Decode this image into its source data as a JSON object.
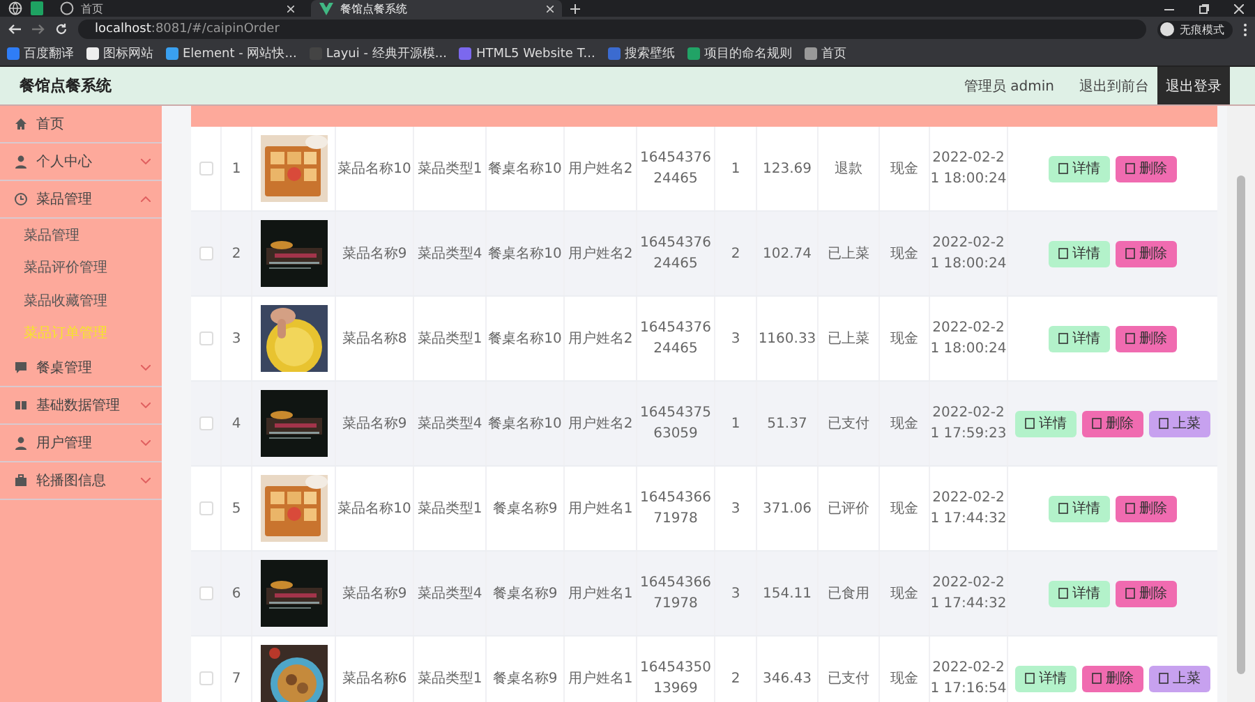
{
  "browser": {
    "tabs": [
      {
        "label": "首页",
        "selected": false
      },
      {
        "label": "餐馆点餐系统",
        "selected": true
      }
    ],
    "address": {
      "host": "localhost",
      "rest": ":8081/#/caipinOrder"
    },
    "bookmarks": [
      "百度翻译",
      "图标网站",
      "Element - 网站快...",
      "Layui - 经典开源模...",
      "HTML5 Website T...",
      "搜索壁纸",
      "项目的命名规则",
      "首页"
    ],
    "profile": "无痕模式"
  },
  "header": {
    "title": "餐馆点餐系统",
    "user": "管理员 admin",
    "links": [
      {
        "label": "退出到前台",
        "selected": false
      },
      {
        "label": "退出登录",
        "selected": true
      }
    ]
  },
  "sidebar": {
    "items": [
      {
        "label": "首页"
      },
      {
        "label": "个人中心",
        "expanded": false
      },
      {
        "label": "菜品管理",
        "expanded": true,
        "children": [
          {
            "label": "菜品管理",
            "selected": false
          },
          {
            "label": "菜品评价管理",
            "selected": false
          },
          {
            "label": "菜品收藏管理",
            "selected": false
          },
          {
            "label": "菜品订单管理",
            "selected": true
          }
        ]
      },
      {
        "label": "餐桌管理",
        "expanded": false
      },
      {
        "label": "基础数据管理",
        "expanded": false
      },
      {
        "label": "用户管理",
        "expanded": false
      },
      {
        "label": "轮播图信息",
        "expanded": false
      }
    ]
  },
  "table": {
    "rows": [
      {
        "checked": false,
        "index": "1",
        "name": "菜品名称10",
        "image": {
          "kind": "picture"
        },
        "type": "菜品类型1",
        "table": "餐桌名称10",
        "user": "用户姓名2",
        "order_no": "1645437624465",
        "qty": "1",
        "price": "123.69",
        "status": "退款",
        "payment": "现金",
        "time": "2022-02-21 18:00:24",
        "actions": [
          {
            "kind": "detail",
            "label": "详情"
          },
          {
            "kind": "delete",
            "label": "删除"
          }
        ]
      },
      {
        "checked": false,
        "index": "2",
        "name": "菜品名称9",
        "image": {
          "kind": "picture"
        },
        "type": "菜品类型4",
        "table": "餐桌名称10",
        "user": "用户姓名2",
        "order_no": "1645437624465",
        "qty": "2",
        "price": "102.74",
        "status": "已上菜",
        "payment": "现金",
        "time": "2022-02-21 18:00:24",
        "actions": [
          {
            "kind": "detail",
            "label": "详情"
          },
          {
            "kind": "delete",
            "label": "删除"
          }
        ]
      },
      {
        "checked": false,
        "index": "3",
        "name": "菜品名称8",
        "image": {
          "kind": "picture"
        },
        "type": "菜品类型1",
        "table": "餐桌名称10",
        "user": "用户姓名2",
        "order_no": "1645437624465",
        "qty": "3",
        "price": "1160.33",
        "status": "已上菜",
        "payment": "现金",
        "time": "2022-02-21 18:00:24",
        "actions": [
          {
            "kind": "detail",
            "label": "详情"
          },
          {
            "kind": "delete",
            "label": "删除"
          }
        ]
      },
      {
        "checked": false,
        "index": "4",
        "name": "菜品名称9",
        "image": {
          "kind": "picture"
        },
        "type": "菜品类型4",
        "table": "餐桌名称10",
        "user": "用户姓名2",
        "order_no": "1645437563059",
        "qty": "1",
        "price": "51.37",
        "status": "已支付",
        "payment": "现金",
        "time": "2022-02-21 17:59:23",
        "actions": [
          {
            "kind": "detail",
            "label": "详情"
          },
          {
            "kind": "delete",
            "label": "删除"
          },
          {
            "kind": "serve",
            "label": "上菜"
          }
        ]
      },
      {
        "checked": false,
        "index": "5",
        "name": "菜品名称10",
        "image": {
          "kind": "picture"
        },
        "type": "菜品类型1",
        "table": "餐桌名称9",
        "user": "用户姓名1",
        "order_no": "1645436671978",
        "qty": "3",
        "price": "371.06",
        "status": "已评价",
        "payment": "现金",
        "time": "2022-02-21 17:44:32",
        "actions": [
          {
            "kind": "detail",
            "label": "详情"
          },
          {
            "kind": "delete",
            "label": "删除"
          }
        ]
      },
      {
        "checked": false,
        "index": "6",
        "name": "菜品名称9",
        "image": {
          "kind": "picture"
        },
        "type": "菜品类型4",
        "table": "餐桌名称9",
        "user": "用户姓名1",
        "order_no": "1645436671978",
        "qty": "3",
        "price": "154.11",
        "status": "已食用",
        "payment": "现金",
        "time": "2022-02-21 17:44:32",
        "actions": [
          {
            "kind": "detail",
            "label": "详情"
          },
          {
            "kind": "delete",
            "label": "删除"
          }
        ]
      },
      {
        "checked": false,
        "index": "7",
        "name": "菜品名称6",
        "image": {
          "kind": "picture"
        },
        "type": "菜品类型1",
        "table": "餐桌名称9",
        "user": "用户姓名1",
        "order_no": "1645435013969",
        "qty": "2",
        "price": "346.43",
        "status": "已支付",
        "payment": "现金",
        "time": "2022-02-21 17:16:54",
        "actions": [
          {
            "kind": "detail",
            "label": "详情"
          },
          {
            "kind": "delete",
            "label": "删除"
          },
          {
            "kind": "serve",
            "label": "上菜"
          }
        ]
      }
    ]
  }
}
